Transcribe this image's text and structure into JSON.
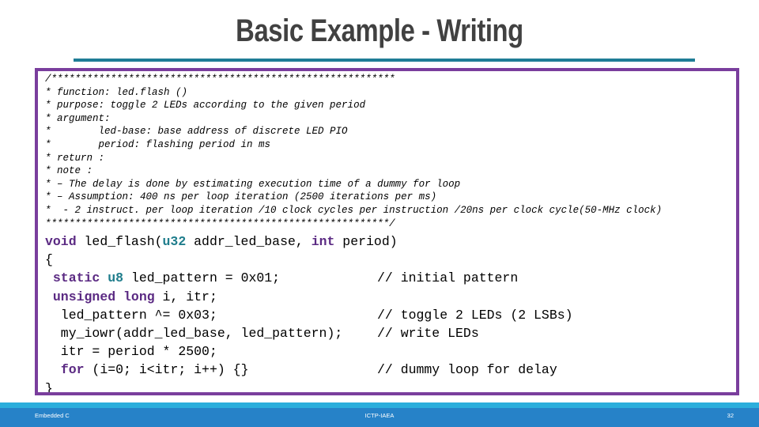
{
  "slide": {
    "title": "Basic Example - Writing",
    "page_number": "32",
    "accent_teal": "#1F7D96",
    "accent_purple": "#7A3E9D",
    "footer_blue": "#2682C8",
    "footer_cyan": "#2BAEDC",
    "title_color": "#414141"
  },
  "footer": {
    "left_label": "Embedded C",
    "center_label": "ICTP-IAEA",
    "page_number": "32"
  },
  "code": {
    "comment_header": [
      "/**********************************************************",
      "* function: led.flash ()",
      "* purpose: toggle 2 LEDs according to the given period",
      "* argument:",
      "*        led-base: base address of discrete LED PIO",
      "*        period: flashing period in ms",
      "* return :",
      "* note :",
      "* – The delay is done by estimating execution time of a dummy for loop",
      "* – Assumption: 400 ns per loop iteration (2500 iterations per ms)",
      "*  - 2 instruct. per loop iteration /10 clock cycles per instruction /20ns per clock cycle(50-MHz clock)",
      "**********************************************************/"
    ],
    "body_lines": [
      {
        "tokens": [
          {
            "t": "void",
            "c": "kw"
          },
          {
            "t": " led_flash(",
            "c": ""
          },
          {
            "t": "u32",
            "c": "ty"
          },
          {
            "t": " addr_led_base, ",
            "c": ""
          },
          {
            "t": "int",
            "c": "kw"
          },
          {
            "t": " period)",
            "c": ""
          }
        ],
        "comment": ""
      },
      {
        "tokens": [
          {
            "t": "{",
            "c": ""
          }
        ],
        "comment": ""
      },
      {
        "tokens": [
          {
            "t": " ",
            "c": ""
          },
          {
            "t": "static",
            "c": "kw"
          },
          {
            "t": " ",
            "c": ""
          },
          {
            "t": "u8",
            "c": "ty"
          },
          {
            "t": " led_pattern = 0x01;",
            "c": ""
          }
        ],
        "comment": "// initial pattern"
      },
      {
        "tokens": [
          {
            "t": " ",
            "c": ""
          },
          {
            "t": "unsigned long",
            "c": "kw"
          },
          {
            "t": " i, itr;",
            "c": ""
          }
        ],
        "comment": ""
      },
      {
        "tokens": [
          {
            "t": "  led_pattern ^= 0x03;",
            "c": ""
          }
        ],
        "comment": "// toggle 2 LEDs (2 LSBs)"
      },
      {
        "tokens": [
          {
            "t": "  my_iowr(addr_led_base, led_pattern);",
            "c": ""
          }
        ],
        "comment": "// write LEDs"
      },
      {
        "tokens": [
          {
            "t": "  itr = period * 2500;",
            "c": ""
          }
        ],
        "comment": ""
      },
      {
        "tokens": [
          {
            "t": "  ",
            "c": ""
          },
          {
            "t": "for",
            "c": "kw"
          },
          {
            "t": " (i=0; i<itr; i++) {}",
            "c": ""
          }
        ],
        "comment": "// dummy loop for delay"
      },
      {
        "tokens": [
          {
            "t": "}",
            "c": ""
          }
        ],
        "comment": ""
      }
    ]
  }
}
